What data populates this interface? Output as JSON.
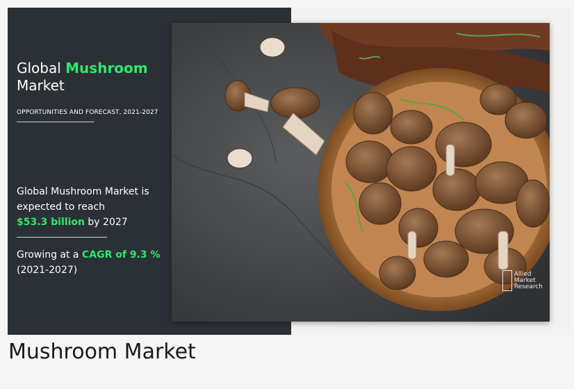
{
  "infographic": {
    "title_prefix": "Global ",
    "title_accent": "Mushroom",
    "title_line2": "Market",
    "subtitle": "OPPORTUNITIES AND FORECAST, 2021-2027",
    "stat1_line1": "Global Mushroom Market is",
    "stat1_line2": "expected to reach",
    "stat1_value": "$53.3 billion",
    "stat1_suffix": " by 2027",
    "stat2_prefix": "Growing at a ",
    "stat2_accent": "CAGR of 9.3 %",
    "stat2_period": "(2021-2027)",
    "accent_color": "#2ee86b",
    "panel_color": "#2b3036"
  },
  "watermark": {
    "line1": "Allied",
    "line2": "Market",
    "line3": "Research"
  },
  "caption": "Mushroom Market"
}
